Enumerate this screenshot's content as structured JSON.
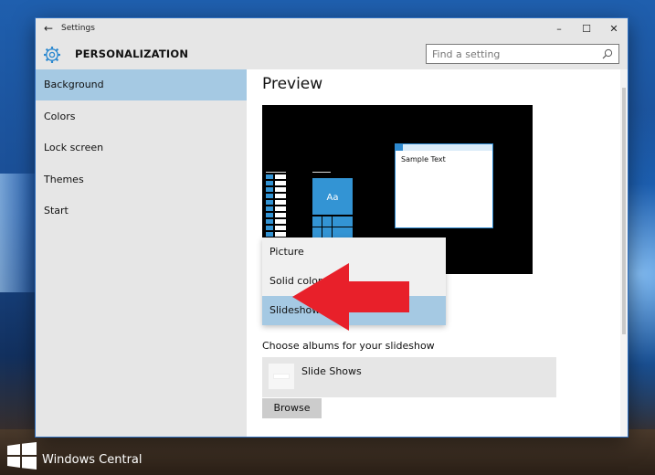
{
  "window": {
    "title": "Settings",
    "minimize": "–",
    "maximize": "☐",
    "close": "✕",
    "back": "←"
  },
  "header": {
    "title": "PERSONALIZATION",
    "search_placeholder": "Find a setting"
  },
  "sidebar": {
    "items": [
      {
        "label": "Background",
        "selected": true
      },
      {
        "label": "Colors",
        "selected": false
      },
      {
        "label": "Lock screen",
        "selected": false
      },
      {
        "label": "Themes",
        "selected": false
      },
      {
        "label": "Start",
        "selected": false
      }
    ]
  },
  "content": {
    "preview_title": "Preview",
    "preview": {
      "sample_text": "Sample Text",
      "tile_label": "Aa"
    },
    "dropdown": {
      "options": [
        "Picture",
        "Solid color",
        "Slideshow"
      ],
      "selected": "Slideshow"
    },
    "albums_label": "Choose albums for your slideshow",
    "album_name": "Slide Shows",
    "browse_label": "Browse"
  },
  "watermark": {
    "text": "Windows Central"
  },
  "colors": {
    "accent": "#3394d4",
    "selection": "#a5c9e3",
    "chrome": "#e6e6e6",
    "arrow": "#e8202a"
  }
}
